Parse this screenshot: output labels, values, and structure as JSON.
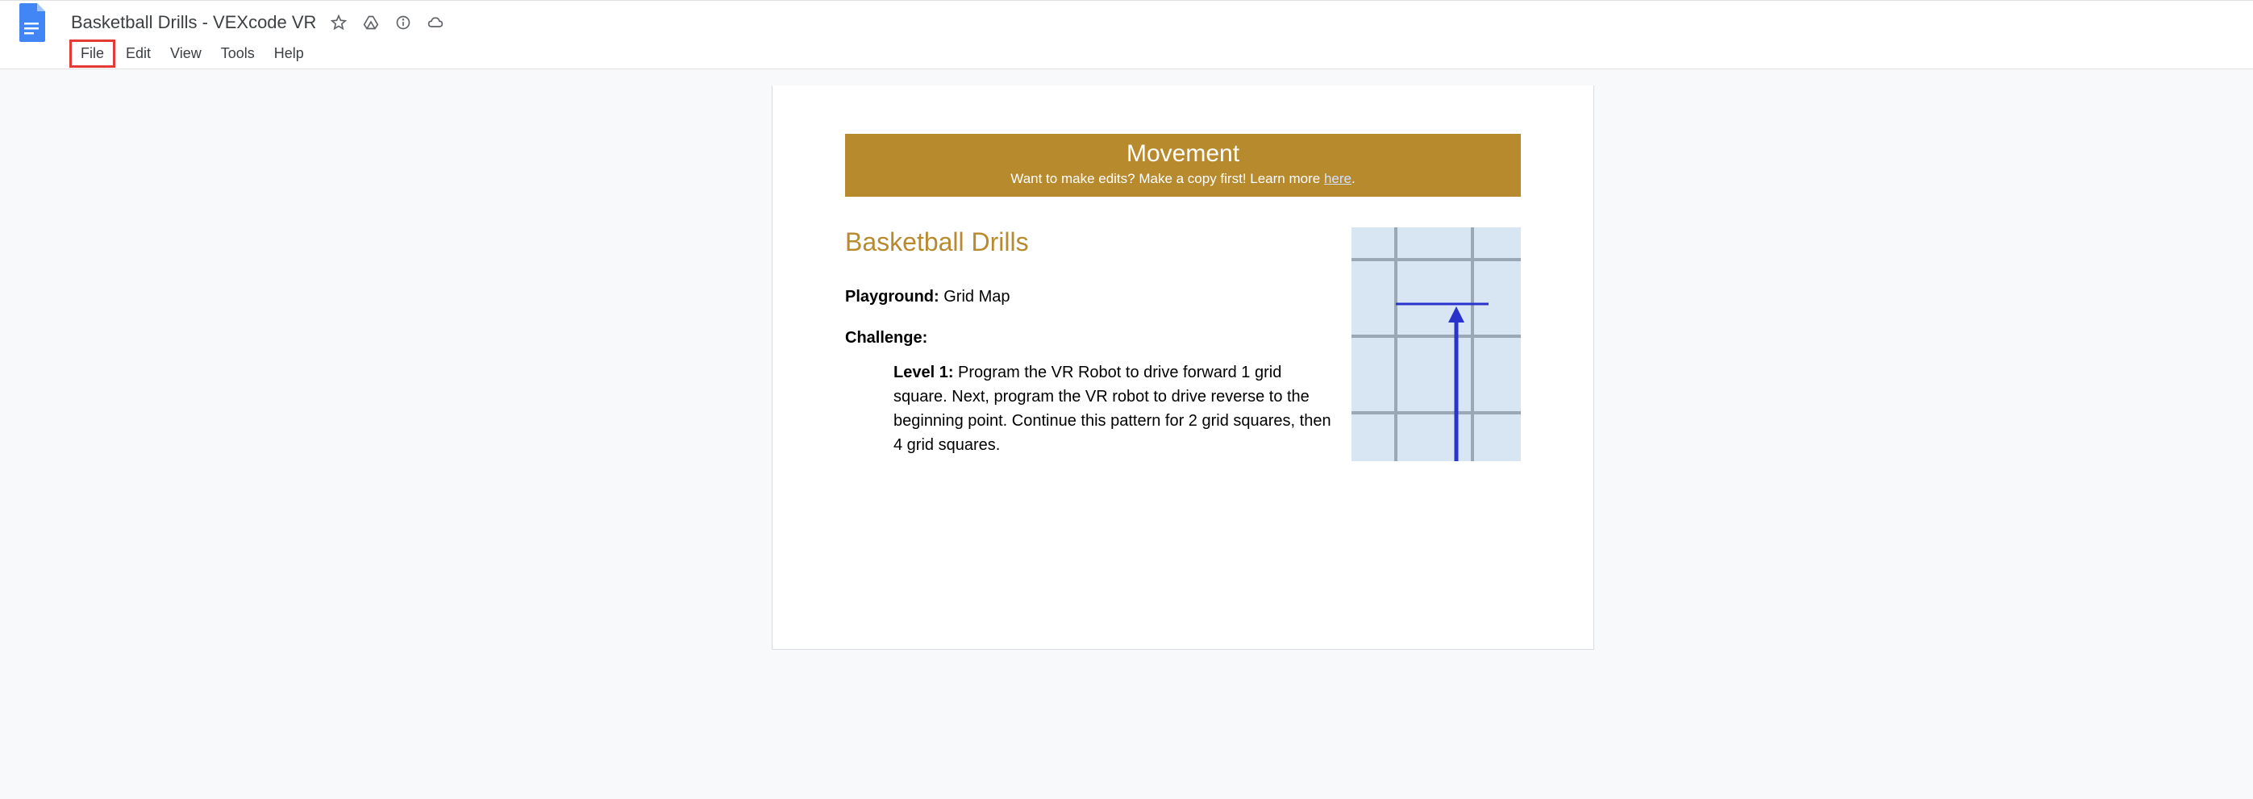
{
  "header": {
    "doc_title": "Basketball Drills - VEXcode VR"
  },
  "menu": {
    "file": "File",
    "edit": "Edit",
    "view": "View",
    "tools": "Tools",
    "help": "Help"
  },
  "banner": {
    "title": "Movement",
    "subtitle_prefix": "Want to make edits? Make a copy first! Learn more ",
    "subtitle_link": "here",
    "subtitle_suffix": "."
  },
  "content": {
    "heading": "Basketball Drills",
    "playground_label": "Playground:",
    "playground_value": " Grid Map",
    "challenge_label": "Challenge:",
    "level1_label": "Level 1:",
    "level1_text": " Program the VR Robot to drive forward 1 grid square. Next, program the VR robot to drive reverse to the beginning point. Continue this pattern for 2 grid squares, then 4 grid squares."
  }
}
